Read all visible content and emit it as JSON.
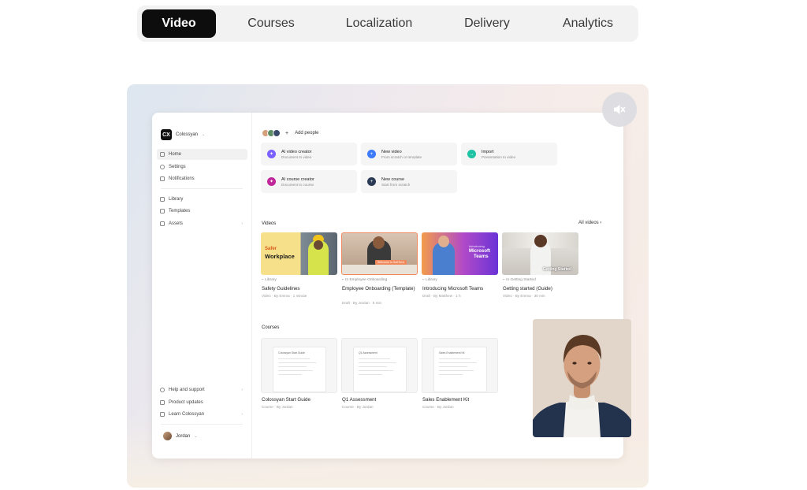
{
  "tabs": [
    {
      "label": "Video",
      "active": true
    },
    {
      "label": "Courses",
      "active": false
    },
    {
      "label": "Localization",
      "active": false
    },
    {
      "label": "Delivery",
      "active": false
    },
    {
      "label": "Analytics",
      "active": false
    }
  ],
  "app": {
    "workspace": {
      "logo": "CX",
      "name": "Colossyan"
    },
    "sidebar_top": [
      {
        "label": "Home",
        "icon": "home-icon",
        "selected": true
      },
      {
        "label": "Settings",
        "icon": "gear-icon"
      },
      {
        "label": "Notifications",
        "icon": "bell-icon"
      }
    ],
    "sidebar_mid": [
      {
        "label": "Library",
        "icon": "folder-icon"
      },
      {
        "label": "Templates",
        "icon": "template-icon"
      },
      {
        "label": "Assets",
        "icon": "asset-icon"
      }
    ],
    "sidebar_bottom": [
      {
        "label": "Help and support",
        "icon": "help-icon"
      },
      {
        "label": "Product updates",
        "icon": "update-icon"
      },
      {
        "label": "Learn Colossyan",
        "icon": "learn-icon"
      }
    ],
    "user_name": "Jordan",
    "add_people": "Add people",
    "quick_actions": [
      {
        "title": "AI video creator",
        "subtitle": "Document to video",
        "color": "#7b61ff"
      },
      {
        "title": "New video",
        "subtitle": "From scratch or template",
        "color": "#3d7bfa"
      },
      {
        "title": "Import",
        "subtitle": "Presentation to video",
        "color": "#1fc3a4"
      },
      {
        "title": "AI course creator",
        "subtitle": "Document to course",
        "color": "#c0279a"
      },
      {
        "title": "New course",
        "subtitle": "Start from scratch",
        "color": "#2b3a55"
      }
    ],
    "videos_title": "Videos",
    "all_videos": "All videos",
    "videos": [
      {
        "folder": "Library",
        "title": "Safety Guidelines",
        "meta": "Video · By Emma · 1 minute",
        "thumb_text": [
          "Safer",
          "Workplace"
        ]
      },
      {
        "folder": "In Employee Onboarding",
        "title": "Employee Onboarding (Template)",
        "meta": "Draft · By Jordan · 5 min",
        "thumb_text": [
          "Welcome to SoftTech"
        ]
      },
      {
        "folder": "Library",
        "title": "Introducing Microsoft Teams",
        "meta": "Draft · By Matthew · 1 h",
        "thumb_text": [
          "Introducing",
          "Microsoft",
          "Teams"
        ]
      },
      {
        "folder": "In Getting Started",
        "title": "Getting started (Guide)",
        "meta": "Video · By Emma · 30 min",
        "thumb_text": [
          "Getting Started"
        ]
      }
    ],
    "courses_title": "Courses",
    "courses": [
      {
        "title": "Colossyan Start Guide",
        "meta": "Course · By Jordan",
        "doc_title": "Colossyan Start Guide"
      },
      {
        "title": "Q1 Assessment",
        "meta": "Course · By Jordan",
        "doc_title": "Q1 Assessment"
      },
      {
        "title": "Sales Enablement Kit",
        "meta": "Course · By Jordan",
        "doc_title": "Sales Enablement Kit"
      }
    ]
  },
  "colors": {
    "tab_active_bg": "#0d0d0d",
    "tab_bar_bg": "#f2f2f2"
  }
}
